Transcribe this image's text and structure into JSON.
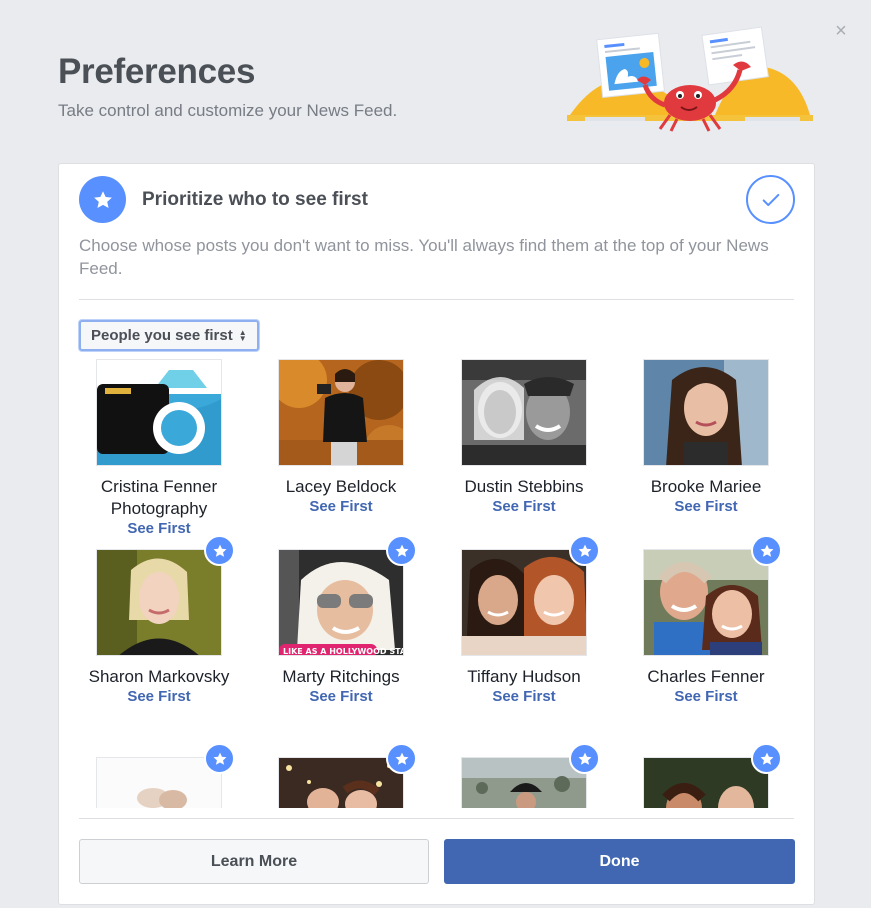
{
  "header": {
    "title": "Preferences",
    "subtitle": "Take control and customize your News Feed.",
    "close_glyph": "×"
  },
  "section": {
    "title": "Prioritize who to see first",
    "description": "Choose whose posts you don't want to miss. You'll always find them at the top of your News Feed.",
    "icon": "star-icon",
    "status_icon": "check-icon"
  },
  "filter": {
    "selected": "People you see first"
  },
  "people": [
    {
      "name": "Cristina Fenner Photography",
      "action": "See First",
      "selected": false
    },
    {
      "name": "Lacey Beldock",
      "action": "See First",
      "selected": false
    },
    {
      "name": "Dustin Stebbins",
      "action": "See First",
      "selected": false
    },
    {
      "name": "Brooke Mariee",
      "action": "See First",
      "selected": false
    },
    {
      "name": "Sharon Markovsky",
      "action": "See First",
      "selected": true
    },
    {
      "name": "Marty Ritchings",
      "action": "See First",
      "selected": true
    },
    {
      "name": "Tiffany Hudson",
      "action": "See First",
      "selected": true
    },
    {
      "name": "Charles Fenner",
      "action": "See First",
      "selected": true
    },
    {
      "name": "",
      "action": "",
      "selected": true
    },
    {
      "name": "",
      "action": "",
      "selected": true
    },
    {
      "name": "",
      "action": "",
      "selected": true
    },
    {
      "name": "",
      "action": "",
      "selected": true
    }
  ],
  "photo_texts": {
    "marty_banner": "LIKE AS A HOLLYWOOD STAR?"
  },
  "buttons": {
    "learn_more": "Learn More",
    "done": "Done"
  },
  "colors": {
    "accent": "#5890ff",
    "primary_button": "#4267b2",
    "link": "#4267b2",
    "background": "#e9ebee"
  }
}
